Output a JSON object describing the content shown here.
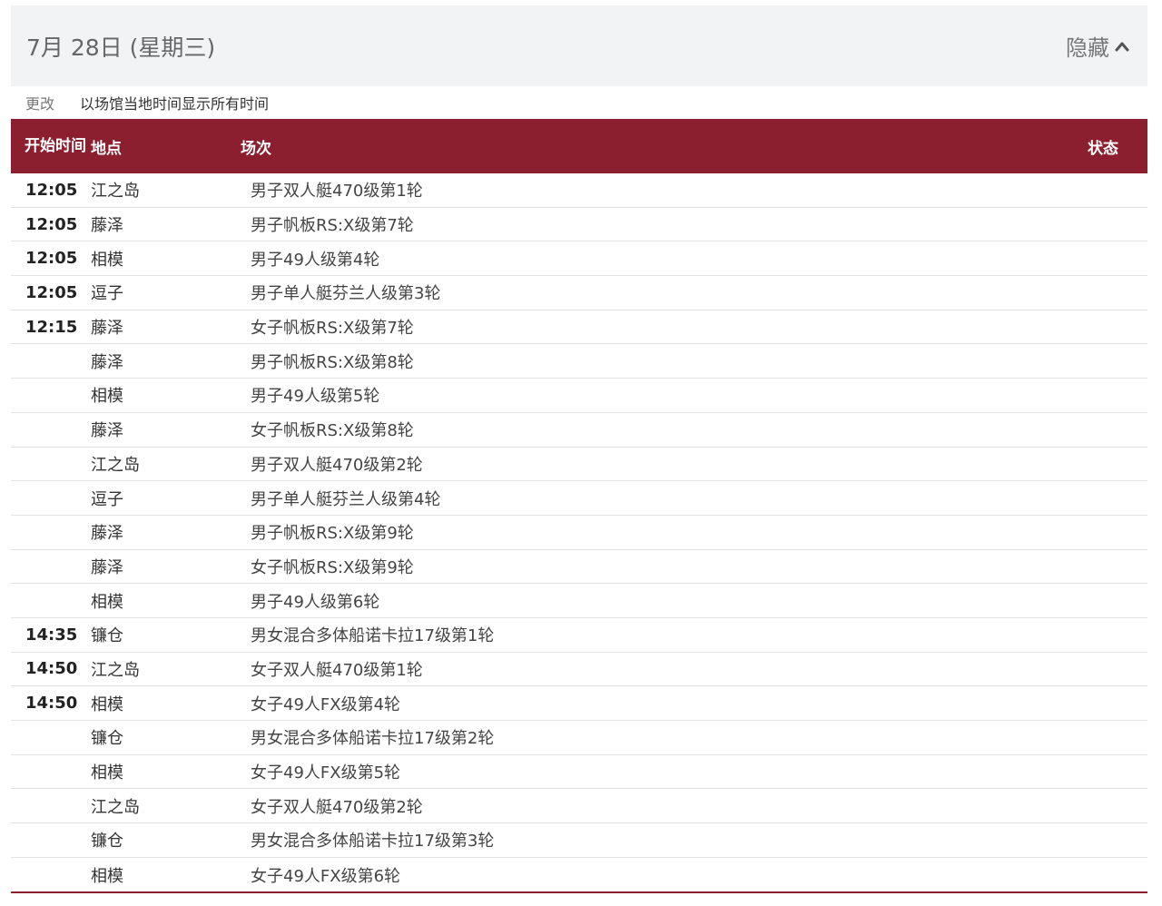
{
  "day": {
    "title": "7月 28日 (星期三)",
    "toggle_label": "隐藏"
  },
  "timezone": {
    "change_label": "更改",
    "text": "以场馆当地时间显示所有时间"
  },
  "columns": {
    "time": "开始时间",
    "venue": "地点",
    "event": "场次",
    "status": "状态"
  },
  "rows": [
    {
      "time": "12:05",
      "venue": "江之岛",
      "event": "男子双人艇470级第1轮",
      "status": ""
    },
    {
      "time": "12:05",
      "venue": "藤泽",
      "event": "男子帆板RS:X级第7轮",
      "status": ""
    },
    {
      "time": "12:05",
      "venue": "相模",
      "event": "男子49人级第4轮",
      "status": ""
    },
    {
      "time": "12:05",
      "venue": "逗子",
      "event": "男子单人艇芬兰人级第3轮",
      "status": ""
    },
    {
      "time": "12:15",
      "venue": "藤泽",
      "event": "女子帆板RS:X级第7轮",
      "status": ""
    },
    {
      "time": "",
      "venue": "藤泽",
      "event": "男子帆板RS:X级第8轮",
      "status": ""
    },
    {
      "time": "",
      "venue": "相模",
      "event": "男子49人级第5轮",
      "status": ""
    },
    {
      "time": "",
      "venue": "藤泽",
      "event": "女子帆板RS:X级第8轮",
      "status": ""
    },
    {
      "time": "",
      "venue": "江之岛",
      "event": "男子双人艇470级第2轮",
      "status": ""
    },
    {
      "time": "",
      "venue": "逗子",
      "event": "男子单人艇芬兰人级第4轮",
      "status": ""
    },
    {
      "time": "",
      "venue": "藤泽",
      "event": "男子帆板RS:X级第9轮",
      "status": ""
    },
    {
      "time": "",
      "venue": "藤泽",
      "event": "女子帆板RS:X级第9轮",
      "status": ""
    },
    {
      "time": "",
      "venue": "相模",
      "event": "男子49人级第6轮",
      "status": ""
    },
    {
      "time": "14:35",
      "venue": "镰仓",
      "event": "男女混合多体船诺卡拉17级第1轮",
      "status": ""
    },
    {
      "time": "14:50",
      "venue": "江之岛",
      "event": "女子双人艇470级第1轮",
      "status": ""
    },
    {
      "time": "14:50",
      "venue": "相模",
      "event": "女子49人FX级第4轮",
      "status": ""
    },
    {
      "time": "",
      "venue": "镰仓",
      "event": "男女混合多体船诺卡拉17级第2轮",
      "status": ""
    },
    {
      "time": "",
      "venue": "相模",
      "event": "女子49人FX级第5轮",
      "status": ""
    },
    {
      "time": "",
      "venue": "江之岛",
      "event": "女子双人艇470级第2轮",
      "status": ""
    },
    {
      "time": "",
      "venue": "镰仓",
      "event": "男女混合多体船诺卡拉17级第3轮",
      "status": ""
    },
    {
      "time": "",
      "venue": "相模",
      "event": "女子49人FX级第6轮",
      "status": ""
    }
  ]
}
